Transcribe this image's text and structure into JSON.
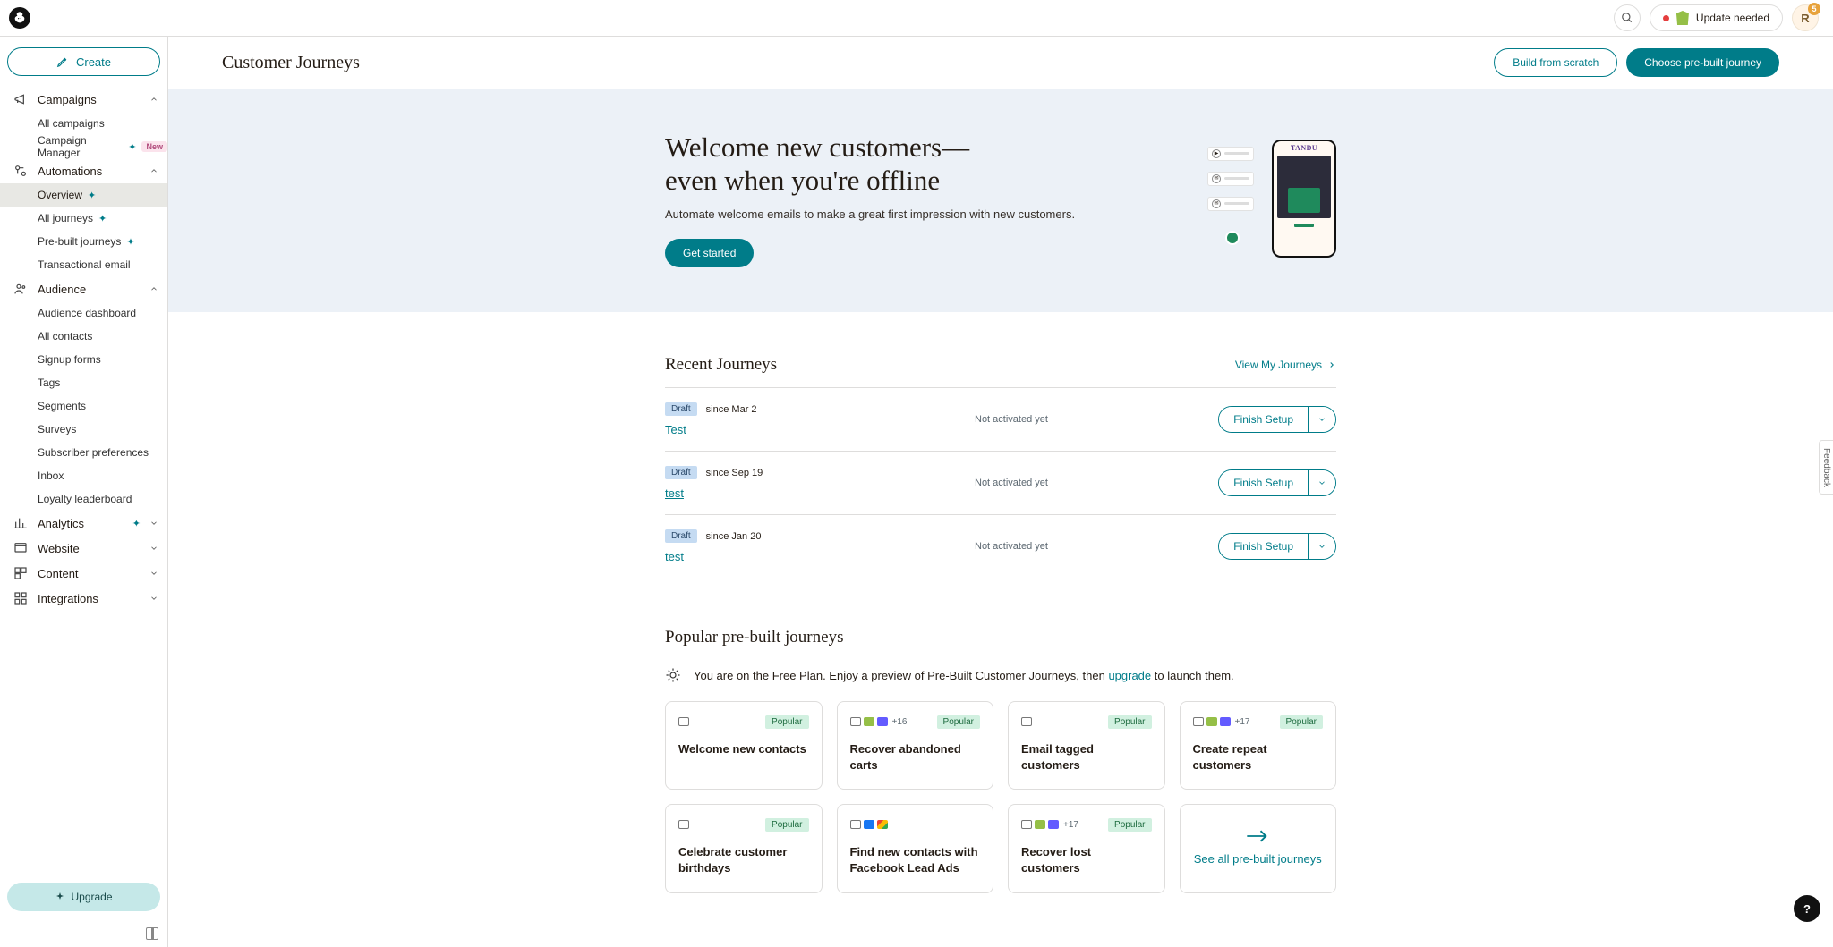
{
  "topbar": {
    "update_label": "Update needed",
    "avatar_letter": "R",
    "avatar_badge": "5"
  },
  "sidebar": {
    "create": "Create",
    "sections": {
      "campaigns": {
        "label": "Campaigns",
        "items": [
          {
            "label": "All campaigns"
          },
          {
            "label": "Campaign Manager",
            "spark": true,
            "new": "New"
          }
        ]
      },
      "automations": {
        "label": "Automations",
        "items": [
          {
            "label": "Overview",
            "spark": true,
            "active": true
          },
          {
            "label": "All journeys",
            "spark": true
          },
          {
            "label": "Pre-built journeys",
            "spark": true
          },
          {
            "label": "Transactional email"
          }
        ]
      },
      "audience": {
        "label": "Audience",
        "items": [
          {
            "label": "Audience dashboard"
          },
          {
            "label": "All contacts"
          },
          {
            "label": "Signup forms"
          },
          {
            "label": "Tags"
          },
          {
            "label": "Segments"
          },
          {
            "label": "Surveys"
          },
          {
            "label": "Subscriber preferences"
          },
          {
            "label": "Inbox"
          },
          {
            "label": "Loyalty leaderboard"
          }
        ]
      },
      "analytics": {
        "label": "Analytics",
        "spark": true
      },
      "website": {
        "label": "Website"
      },
      "content": {
        "label": "Content"
      },
      "integrations": {
        "label": "Integrations"
      }
    },
    "upgrade": "Upgrade"
  },
  "header": {
    "title": "Customer Journeys",
    "build": "Build from scratch",
    "choose": "Choose pre-built journey"
  },
  "hero": {
    "title_l1": "Welcome new customers—",
    "title_l2": "even when you're offline",
    "body": "Automate welcome emails to make a great first impression with new customers.",
    "cta": "Get started",
    "phone_brand": "TANDU"
  },
  "recent": {
    "title": "Recent Journeys",
    "view_label": "View My Journeys",
    "status_chip": "Draft",
    "not_activated": "Not activated yet",
    "finish": "Finish Setup",
    "rows": [
      {
        "name": "Test",
        "since": "since Mar 2"
      },
      {
        "name": "test",
        "since": "since Sep 19"
      },
      {
        "name": "test",
        "since": "since Jan 20"
      }
    ]
  },
  "popular": {
    "title": "Popular pre-built journeys",
    "note_pre": "You are on the Free Plan. Enjoy a preview of Pre-Built Customer Journeys, then ",
    "note_link": "upgrade",
    "note_post": " to launch them.",
    "pill": "Popular",
    "see_all": "See all pre-built journeys",
    "cards": [
      {
        "title": "Welcome new contacts",
        "icons": [
          "mail"
        ],
        "count": "",
        "popular": true
      },
      {
        "title": "Recover abandoned carts",
        "icons": [
          "mail",
          "shop",
          "stripe"
        ],
        "count": "+16",
        "popular": true
      },
      {
        "title": "Email tagged customers",
        "icons": [
          "mail"
        ],
        "count": "",
        "popular": true
      },
      {
        "title": "Create repeat customers",
        "icons": [
          "mail",
          "shop",
          "stripe"
        ],
        "count": "+17",
        "popular": true
      },
      {
        "title": "Celebrate customer birthdays",
        "icons": [
          "mail"
        ],
        "count": "",
        "popular": true
      },
      {
        "title": "Find new contacts with Facebook Lead Ads",
        "icons": [
          "mail",
          "fb",
          "gads"
        ],
        "count": "",
        "popular": false
      },
      {
        "title": "Recover lost customers",
        "icons": [
          "mail",
          "shop",
          "stripe"
        ],
        "count": "+17",
        "popular": true
      }
    ]
  },
  "feedback": "Feedback",
  "help": "?"
}
